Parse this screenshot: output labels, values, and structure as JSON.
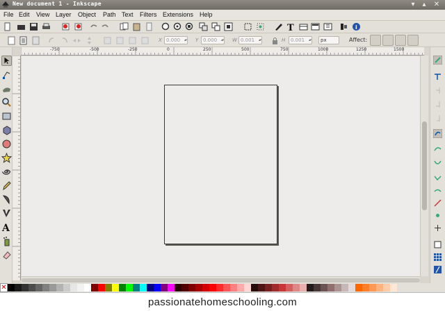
{
  "window": {
    "title": "New document 1 - Inkscape"
  },
  "menu": [
    "File",
    "Edit",
    "View",
    "Layer",
    "Object",
    "Path",
    "Text",
    "Filters",
    "Extensions",
    "Help"
  ],
  "controls": {
    "x_label": "X",
    "x_value": "0.000",
    "y_label": "Y",
    "y_value": "0.000",
    "w_label": "W",
    "w_value": "0.001",
    "h_label": "H",
    "h_value": "0.001",
    "unit": "px",
    "affect_label": "Affect:"
  },
  "ruler": {
    "h_labels": [
      "-750",
      "-500",
      "-250",
      "0",
      "250",
      "500",
      "750",
      "1000",
      "1250",
      "1500"
    ]
  },
  "palette": {
    "none_label": "✕",
    "swatches": [
      "#000000",
      "#1a1a1a",
      "#333333",
      "#4d4d4d",
      "#666666",
      "#808080",
      "#999999",
      "#b3b3b3",
      "#cccccc",
      "#e6e6e6",
      "#f2f2f2",
      "#ffffff",
      "#800000",
      "#ff0000",
      "#808000",
      "#ffff00",
      "#008000",
      "#00ff00",
      "#008080",
      "#00ffff",
      "#000080",
      "#0000ff",
      "#800080",
      "#ff00ff",
      "#2b0000",
      "#550000",
      "#800000",
      "#aa0000",
      "#d40000",
      "#ff0000",
      "#ff2a2a",
      "#ff5555",
      "#ff8080",
      "#ffaaaa",
      "#ffd5d5",
      "#280b0b",
      "#501616",
      "#782121",
      "#a02c2c",
      "#c83737",
      "#d35f5f",
      "#de8787",
      "#e9afaf",
      "#241c1c",
      "#483737",
      "#6c5353",
      "#916f6f",
      "#ac9393",
      "#c8b7b7",
      "#e3dbdb",
      "#ff6600",
      "#ff7f2a",
      "#ff9955",
      "#ffb380",
      "#ffccaa",
      "#ffe6d5"
    ]
  },
  "caption": {
    "text": "passionatehomeschooling.com"
  },
  "colors": {
    "accent": "#8a8580",
    "canvas": "#edeceb",
    "page_border": "#3c3a38"
  }
}
